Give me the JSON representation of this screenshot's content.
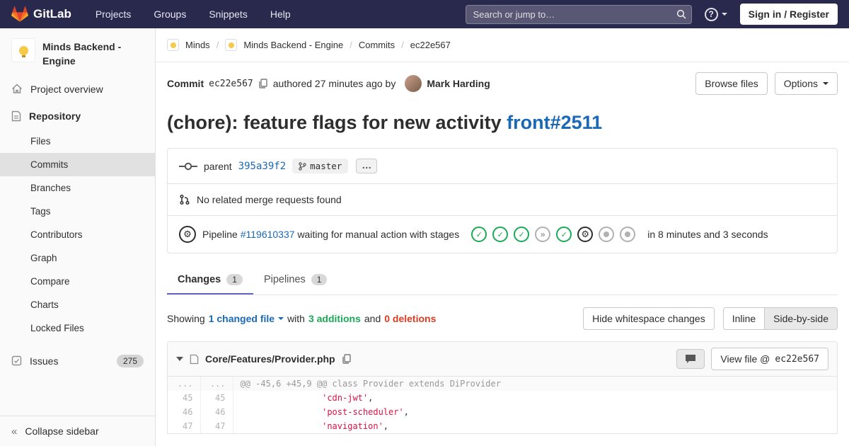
{
  "icons": {
    "help": "?",
    "collapse": "«",
    "check": "✓",
    "skipped": "»",
    "gear": "⚙",
    "ellipsis": "…"
  },
  "navbar": {
    "brand": "GitLab",
    "menu": [
      "Projects",
      "Groups",
      "Snippets",
      "Help"
    ],
    "search_placeholder": "Search or jump to…",
    "sign_in": "Sign in / Register"
  },
  "sidebar": {
    "project_name": "Minds Backend - Engine",
    "overview_label": "Project overview",
    "repository_label": "Repository",
    "repo_items": [
      "Files",
      "Commits",
      "Branches",
      "Tags",
      "Contributors",
      "Graph",
      "Compare",
      "Charts",
      "Locked Files"
    ],
    "issues_label": "Issues",
    "issues_count": "275",
    "collapse_label": "Collapse sidebar"
  },
  "breadcrumb": {
    "items": [
      "Minds",
      "Minds Backend - Engine",
      "Commits",
      "ec22e567"
    ],
    "separator": "/"
  },
  "commit": {
    "label": "Commit",
    "sha": "ec22e567",
    "authored": "authored 27 minutes ago by",
    "author": "Mark Harding",
    "browse_files": "Browse files",
    "options": "Options",
    "title_text": "(chore): feature flags for new activity",
    "title_link": "front#2511",
    "parent_label": "parent",
    "parent_sha": "395a39f2",
    "branch": "master",
    "no_mr_text": "No related merge requests found",
    "pipeline_label": "Pipeline",
    "pipeline_id": "#119610337",
    "pipeline_status": "waiting for manual action with stages",
    "pipeline_duration": "in 8 minutes and 3 seconds",
    "stages": [
      "passed",
      "passed",
      "passed",
      "skipped",
      "passed",
      "manual",
      "created",
      "created"
    ]
  },
  "tabs": [
    {
      "label": "Changes",
      "count": "1"
    },
    {
      "label": "Pipelines",
      "count": "1"
    }
  ],
  "summary": {
    "showing": "Showing",
    "changed_file": "1 changed file",
    "with": "with",
    "additions": "3 additions",
    "and": "and",
    "deletions": "0 deletions",
    "hide_whitespace": "Hide whitespace changes",
    "inline": "Inline",
    "side_by_side": "Side-by-side"
  },
  "diff": {
    "file_name": "Core/Features/Provider.php",
    "view_file_prefix": "View file @",
    "view_file_sha": "ec22e567",
    "hunk": {
      "old": "...",
      "new": "...",
      "text": "@@ -45,6 +45,9 @@ class Provider extends DiProvider"
    },
    "lines": [
      {
        "old": "45",
        "new": "45",
        "indent": "                ",
        "code": "'cdn-jwt'",
        "tail": ","
      },
      {
        "old": "46",
        "new": "46",
        "indent": "                ",
        "code": "'post-scheduler'",
        "tail": ","
      },
      {
        "old": "47",
        "new": "47",
        "indent": "                ",
        "code": "'navigation'",
        "tail": ","
      }
    ]
  }
}
